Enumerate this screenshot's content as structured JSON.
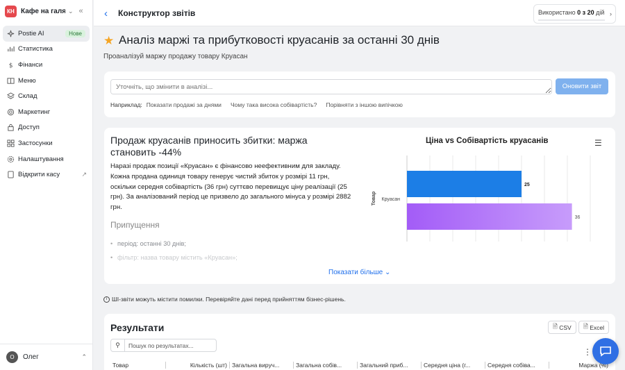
{
  "sidebar": {
    "brand_initials": "КН",
    "brand_name": "Кафе на галя...",
    "items": [
      {
        "label": "Postie AI",
        "badge": "Нове",
        "icon": "sparkle-icon"
      },
      {
        "label": "Статистика",
        "icon": "bar-chart-icon"
      },
      {
        "label": "Фінанси",
        "icon": "dollar-icon"
      },
      {
        "label": "Меню",
        "icon": "book-icon"
      },
      {
        "label": "Склад",
        "icon": "layers-icon"
      },
      {
        "label": "Маркетинг",
        "icon": "target-icon"
      },
      {
        "label": "Доступ",
        "icon": "lock-icon"
      },
      {
        "label": "Застосунки",
        "icon": "grid-icon"
      },
      {
        "label": "Налаштування",
        "icon": "gear-icon"
      },
      {
        "label": "Відкрити касу",
        "icon": "tablet-icon"
      }
    ],
    "user_initial": "О",
    "user_name": "Олег"
  },
  "header": {
    "title": "Конструктор звітів",
    "usage_prefix": "Використано ",
    "usage_value": "0 з 20",
    "usage_suffix": " дій",
    "usage_fraction": 0.0
  },
  "page": {
    "title": "Аналіз маржі та прибутковості круасанів за останні 30 днів",
    "subtitle": "Проаналізуй маржу продажу товару Круасан"
  },
  "refine": {
    "placeholder": "Уточніть, що змінити в аналізі...",
    "button": "Оновити звіт",
    "examples_label": "Наприклад:",
    "examples": [
      "Показати продажі за днями",
      "Чому така висока собівартість?",
      "Порівняти з іншою випічкою"
    ]
  },
  "analysis": {
    "title": "Продаж круасанів приносить збитки: маржа становить -44%",
    "body": "Наразі продаж позиції «Круасан» є фінансово неефективним для закладу. Кожна продана одиниця товару генерує чистий збиток у розмірі 11 грн, оскільки середня собівартість (36 грн) суттєво перевищує ціну реалізації (25 грн). За аналізований період це призвело до загального мінуса у розмірі 2882 грн.",
    "assumptions_title": "Припущення",
    "assumptions": [
      "період: останні 30 днів;",
      "фільтр: назва товару містить «Круасан»;"
    ],
    "show_more": "Показати більше"
  },
  "chart_data": {
    "type": "bar",
    "orientation": "horizontal",
    "title": "Ціна vs Собівартість круасанів",
    "xlabel": "",
    "ylabel": "Товар",
    "categories": [
      "Круасан"
    ],
    "series": [
      {
        "values": [
          25
        ],
        "color": "#1c7ee6"
      },
      {
        "values": [
          36
        ],
        "color": "#a35cf7"
      }
    ],
    "xlim": [
      0,
      40
    ],
    "grid": true
  },
  "disclaimer": "ШІ-звіти можуть містити помилки. Перевіряйте дані перед прийняттям бізнес-рішень.",
  "results": {
    "title": "Результати",
    "csv": "CSV",
    "excel": "Excel",
    "search_placeholder": "Пошук по результатах...",
    "columns": [
      "Товар",
      "Кількість (шт)",
      "Загальна вируч...",
      "Загальна собів...",
      "Загальний приб...",
      "Середня ціна (г...",
      "Середня собіва...",
      "Маржа (%)"
    ]
  }
}
